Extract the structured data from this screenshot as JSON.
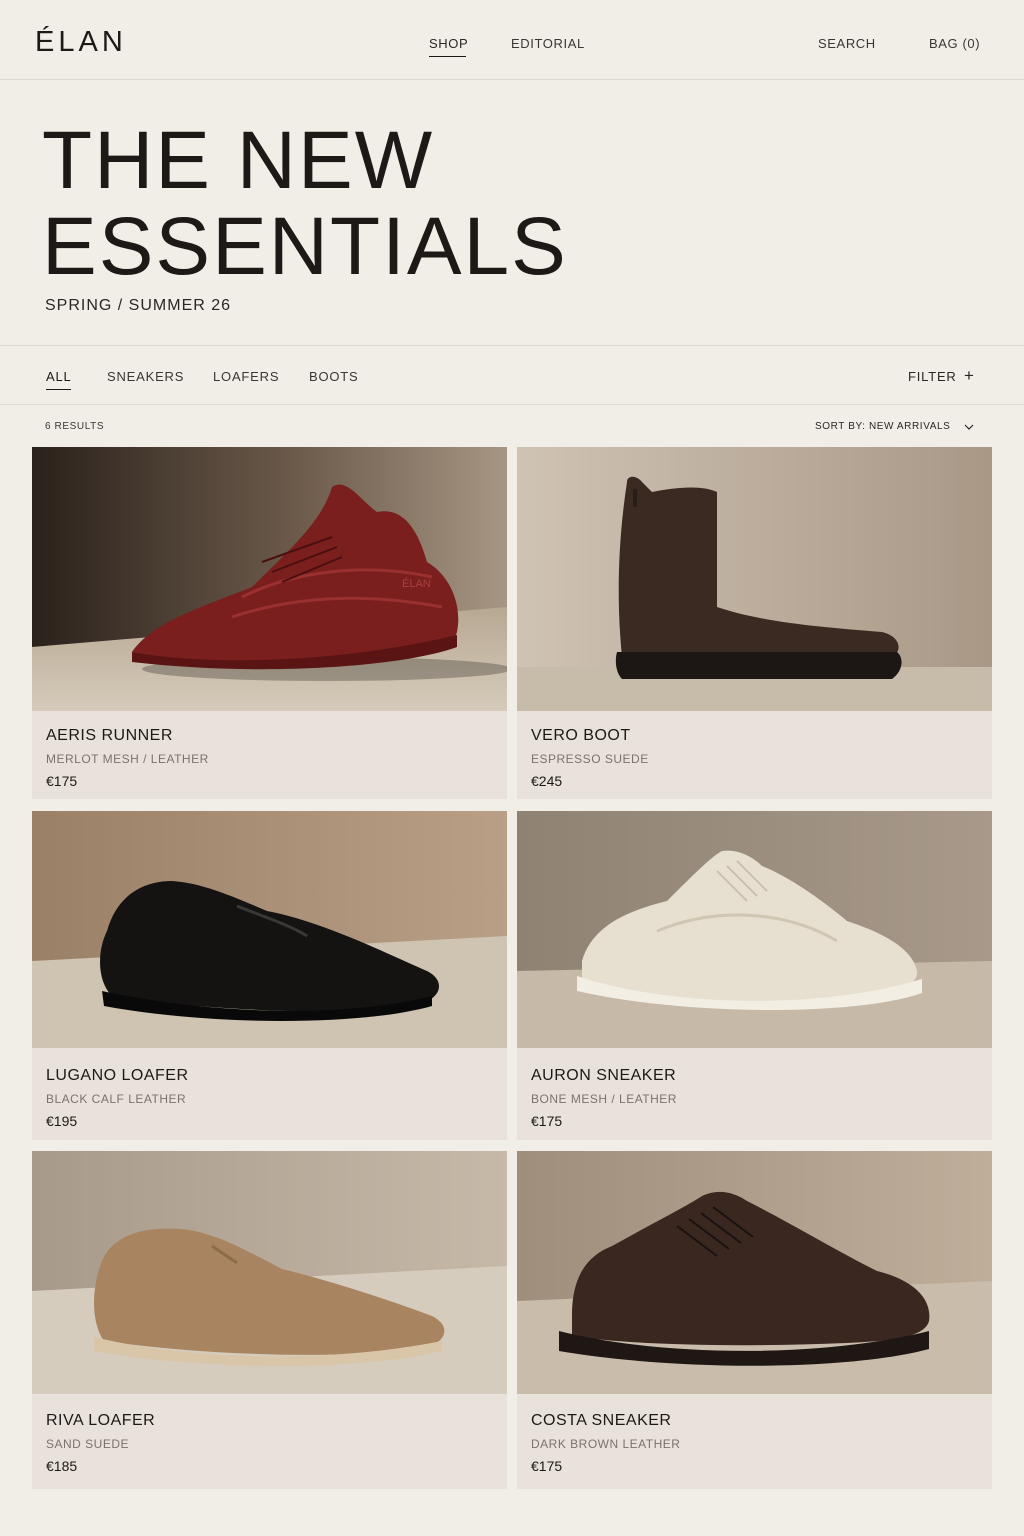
{
  "header": {
    "logo": "ÉLAN",
    "nav": {
      "shop": "SHOP",
      "editorial": "EDITORIAL"
    },
    "search": "SEARCH",
    "bag": "BAG (0)"
  },
  "hero": {
    "title_line1": "THE NEW",
    "title_line2": "ESSENTIALS",
    "subtitle": "SPRING / SUMMER 26"
  },
  "categories": {
    "tabs": [
      "ALL",
      "SNEAKERS",
      "LOAFERS",
      "BOOTS"
    ],
    "active": "ALL",
    "filter": "FILTER",
    "filter_icon": "plus-icon"
  },
  "listing": {
    "results": "6 RESULTS",
    "sort": "SORT BY: NEW ARRIVALS",
    "sort_icon": "chevron-down-icon"
  },
  "products": [
    {
      "name": "AERIS RUNNER",
      "material": "MERLOT MESH / LEATHER",
      "price": "€175",
      "color": "#7a1e1e",
      "image": "sneaker-icon",
      "logo_text": "ÉLAN"
    },
    {
      "name": "VERO BOOT",
      "material": "ESPRESSO SUEDE",
      "price": "€245",
      "color": "#3b2a22",
      "image": "boot-icon"
    },
    {
      "name": "LUGANO LOAFER",
      "material": "BLACK CALF LEATHER",
      "price": "€195",
      "color": "#141312",
      "image": "loafer-icon"
    },
    {
      "name": "AURON SNEAKER",
      "material": "BONE MESH / LEATHER",
      "price": "€175",
      "color": "#e7e0d0",
      "image": "sneaker-icon"
    },
    {
      "name": "RIVA LOAFER",
      "material": "SAND SUEDE",
      "price": "€185",
      "color": "#a88560",
      "image": "loafer-icon"
    },
    {
      "name": "COSTA SNEAKER",
      "material": "DARK BROWN LEATHER",
      "price": "€175",
      "color": "#3a2720",
      "image": "sneaker-icon"
    }
  ]
}
